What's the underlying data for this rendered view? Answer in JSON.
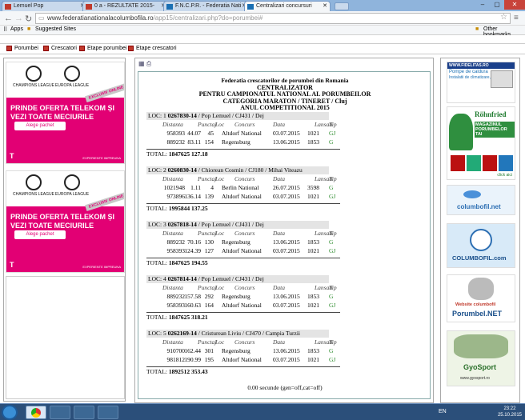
{
  "browser": {
    "tabs": [
      {
        "label": "Lemuel Pop"
      },
      {
        "label": "0 a - REZULTATE 2015-"
      },
      {
        "label": "F.N.C.P.R. - Federatia Nati"
      },
      {
        "label": "Centralizari concursuri"
      }
    ],
    "url_host": "www.federatianationalacolumbofila.ro",
    "url_path": "/app15/centralizari.php?do=porumbei#",
    "bookmarks": [
      {
        "label": "Apps"
      },
      {
        "label": "Suggested Sites"
      }
    ],
    "other_bookmarks": "Other bookmarks"
  },
  "site_nav": [
    {
      "label": "Porumbei"
    },
    {
      "label": "Crescatori"
    },
    {
      "label": "Etape porumbei"
    },
    {
      "label": "Etape crescatori"
    }
  ],
  "ads": {
    "left": [
      {
        "logo1": "CHAMPIONS LEAGUE",
        "logo2": "EUROPA LEAGUE",
        "exclusive": "EXCLUSIV ONLINE",
        "title": "PRINDE OFERTA TELEKOM ȘI VEZI TOATE MECIURILE",
        "button": "Alege pachet",
        "brand": "T",
        "tagline": "EXPERIENTE IMPREUNA"
      },
      {
        "logo1": "CHAMPIONS LEAGUE",
        "logo2": "EUROPA LEAGUE",
        "exclusive": "EXCLUSIV ONLINE",
        "title": "PRINDE OFERTA TELEKOM ȘI VEZI TOATE MECIURILE",
        "button": "Alege pachet",
        "brand": "T",
        "tagline": "EXPERIENTE IMPREUNA"
      }
    ],
    "right": [
      {
        "title": "WWW.FIDELITAS.RO",
        "line1": "Pompe de caldura",
        "line2": "Instalatii de climatizare, ventilatie"
      },
      {
        "title": "Röhnfried",
        "line1": "MAGAZINUL PORUMBELOR TAI",
        "line2": "click aici"
      },
      {
        "title": "columbofil.net"
      },
      {
        "title": "COLUMBOFIL.com"
      },
      {
        "title": "Website columbofil",
        "line1": "Porumbel.NET"
      },
      {
        "title": "GyoSport",
        "line1": "www.gyosport.ro"
      }
    ]
  },
  "report": {
    "header": [
      "Federatia crescatorilor de porumbei din Romania",
      "CENTRALIZATOR",
      "PENTRU CAMPIONATUL NATIONAL AL PORUMBEILOR",
      "CATEGORIA MARATON / TINERET / Cluj",
      "ANUL COMPETITIONAL 2015"
    ],
    "columns": [
      "Distanta",
      "Punctaj",
      "Loc",
      "Concurs",
      "Data",
      "Lansati",
      "Tip"
    ],
    "entries": [
      {
        "loc": "LOC: 1",
        "ring": "0267830-14",
        "owner": "/ Pop Lemuel / CJ431 / Dej",
        "rows": [
          [
            "958393",
            "44.07",
            "45",
            "Altdorf National",
            "03.07.2015",
            "1021",
            "GJ"
          ],
          [
            "889232",
            "83.11",
            "154",
            "Regensburg",
            "13.06.2015",
            "1853",
            "G"
          ]
        ],
        "total_dist": "1847625",
        "total_pts": "127.18"
      },
      {
        "loc": "LOC: 2",
        "ring": "0260830-14",
        "owner": "/ Chiorean Cosmin / CJ180 / Mihai Viteazu",
        "rows": [
          [
            "1021948",
            "1.11",
            "4",
            "Berlin National",
            "26.07.2015",
            "3598",
            "G"
          ],
          [
            "973896",
            "136.14",
            "139",
            "Altdorf National",
            "03.07.2015",
            "1021",
            "GJ"
          ]
        ],
        "total_dist": "1995844",
        "total_pts": "137.25"
      },
      {
        "loc": "LOC: 3",
        "ring": "0267818-14",
        "owner": "/ Pop Lemuel / CJ431 / Dej",
        "rows": [
          [
            "889232",
            "70.16",
            "130",
            "Regensburg",
            "13.06.2015",
            "1853",
            "G"
          ],
          [
            "958393",
            "124.39",
            "127",
            "Altdorf National",
            "03.07.2015",
            "1021",
            "GJ"
          ]
        ],
        "total_dist": "1847625",
        "total_pts": "194.55"
      },
      {
        "loc": "LOC: 4",
        "ring": "0267814-14",
        "owner": "/ Pop Lemuel / CJ431 / Dej",
        "rows": [
          [
            "889232",
            "157.58",
            "292",
            "Regensburg",
            "13.06.2015",
            "1853",
            "G"
          ],
          [
            "958393",
            "160.63",
            "164",
            "Altdorf National",
            "03.07.2015",
            "1021",
            "GJ"
          ]
        ],
        "total_dist": "1847625",
        "total_pts": "318.21"
      },
      {
        "loc": "LOC: 5",
        "ring": "0262169-14",
        "owner": "/ Cristurean Liviu / CJ470 / Campia Turzii",
        "rows": [
          [
            "910700",
            "162.44",
            "301",
            "Regensburg",
            "13.06.2015",
            "1853",
            "G"
          ],
          [
            "981812",
            "190.99",
            "195",
            "Altdorf National",
            "03.07.2015",
            "1021",
            "GJ"
          ]
        ],
        "total_dist": "1892512",
        "total_pts": "353.43"
      }
    ],
    "total_label": "TOTAL:",
    "footer": "0.00 secunde (gen=off,cat=off)"
  },
  "taskbar": {
    "lang": "EN",
    "time": "23:22",
    "date": "25.10.2015"
  }
}
